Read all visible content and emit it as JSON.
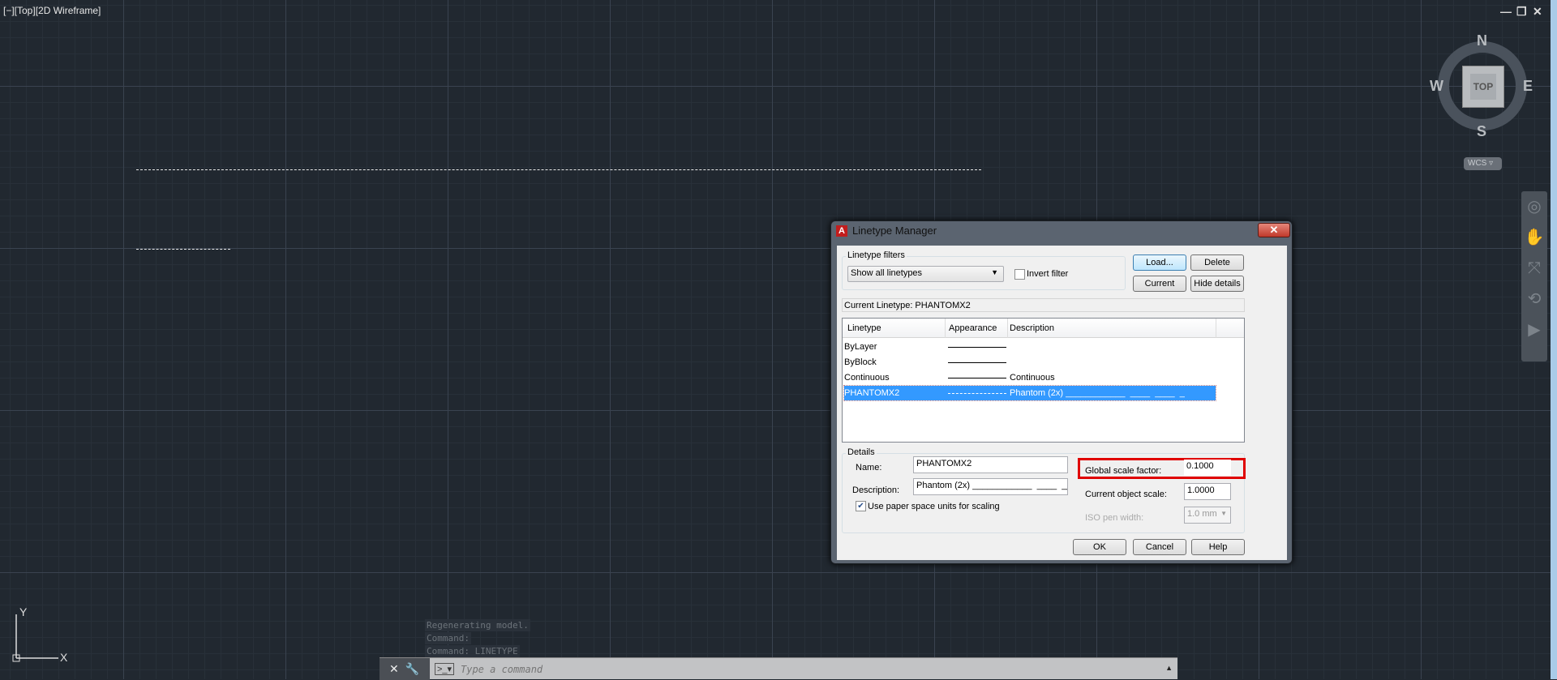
{
  "viewport": {
    "label": "[−][Top][2D Wireframe]"
  },
  "window_controls": {
    "minimize": "—",
    "restore": "❐",
    "close": "✕"
  },
  "viewcube": {
    "n": "N",
    "s": "S",
    "e": "E",
    "w": "W",
    "face": "TOP",
    "ucs": "WCS"
  },
  "ucs_icon": {
    "x": "X",
    "y": "Y"
  },
  "dialog": {
    "title": "Linetype Manager",
    "close": "✕",
    "filters_label": "Linetype filters",
    "filter_value": "Show all linetypes",
    "invert_filter": "Invert filter",
    "buttons": {
      "load": "Load...",
      "delete": "Delete",
      "current": "Current",
      "hide_details": "Hide details",
      "ok": "OK",
      "cancel": "Cancel",
      "help": "Help"
    },
    "current_linetype": "Current Linetype:  PHANTOMX2",
    "columns": [
      "Linetype",
      "Appearance",
      "Description"
    ],
    "rows": [
      {
        "name": "ByLayer",
        "description": ""
      },
      {
        "name": "ByBlock",
        "description": ""
      },
      {
        "name": "Continuous",
        "description": "Continuous"
      },
      {
        "name": "PHANTOMX2",
        "description": "Phantom (2x) ____________  ____  ____  _"
      }
    ],
    "details": {
      "label": "Details",
      "name_label": "Name:",
      "name_value": "PHANTOMX2",
      "description_label": "Description:",
      "description_value": "Phantom (2x) ____________  ____  ____",
      "paper_space": "Use paper space units for scaling",
      "global_scale_label": "Global scale factor:",
      "global_scale_value": "0.1000",
      "object_scale_label": "Current object scale:",
      "object_scale_value": "1.0000",
      "iso_pen_label": "ISO pen width:",
      "iso_pen_value": "1.0 mm"
    }
  },
  "command": {
    "history": [
      "Regenerating model.",
      "Command:",
      "Command: LINETYPE"
    ],
    "placeholder": "Type a command"
  },
  "colors": {
    "highlight": "#e00000",
    "selection": "#3399ff"
  }
}
